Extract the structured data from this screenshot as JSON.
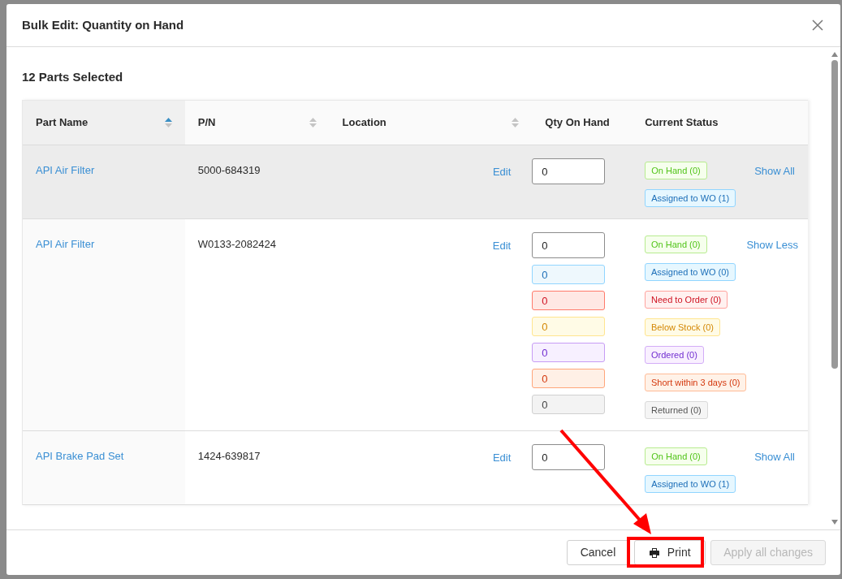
{
  "dialog": {
    "title": "Bulk Edit: Quantity on Hand",
    "subtitle": "12 Parts Selected"
  },
  "columns": [
    {
      "label": "Part Name",
      "sort_active": true
    },
    {
      "label": "P/N",
      "sort_active": false
    },
    {
      "label": "Location",
      "sort_active": false
    },
    {
      "label": "Qty On Hand"
    },
    {
      "label": "Current Status"
    }
  ],
  "rows": [
    {
      "part_name": "API Air Filter",
      "pn": "5000-684319",
      "edit": "Edit",
      "highlighted": true,
      "toggle": "Show All",
      "quantities": [
        {
          "value": "0",
          "kind": "on_hand"
        }
      ],
      "statuses": [
        {
          "label": "On Hand (0)",
          "kind": "on_hand"
        },
        {
          "label": "Assigned to WO (1)",
          "kind": "assigned"
        }
      ]
    },
    {
      "part_name": "API Air Filter",
      "pn": "W0133-2082424",
      "edit": "Edit",
      "highlighted": false,
      "toggle": "Show Less",
      "quantities": [
        {
          "value": "0",
          "kind": "on_hand"
        },
        {
          "value": "0",
          "kind": "assigned"
        },
        {
          "value": "0",
          "kind": "need"
        },
        {
          "value": "0",
          "kind": "below"
        },
        {
          "value": "0",
          "kind": "ordered"
        },
        {
          "value": "0",
          "kind": "short"
        },
        {
          "value": "0",
          "kind": "returned"
        }
      ],
      "statuses": [
        {
          "label": "On Hand (0)",
          "kind": "on_hand"
        },
        {
          "label": "Assigned to WO (0)",
          "kind": "assigned"
        },
        {
          "label": "Need to Order (0)",
          "kind": "need"
        },
        {
          "label": "Below Stock (0)",
          "kind": "below"
        },
        {
          "label": "Ordered (0)",
          "kind": "ordered"
        },
        {
          "label": "Short within 3 days (0)",
          "kind": "short"
        },
        {
          "label": "Returned (0)",
          "kind": "returned"
        }
      ]
    },
    {
      "part_name": "API Brake Pad Set",
      "pn": "1424-639817",
      "edit": "Edit",
      "highlighted": false,
      "toggle": "Show All",
      "quantities": [
        {
          "value": "0",
          "kind": "on_hand"
        }
      ],
      "statuses": [
        {
          "label": "On Hand (0)",
          "kind": "on_hand"
        },
        {
          "label": "Assigned to WO (1)",
          "kind": "assigned"
        }
      ]
    }
  ],
  "footer": {
    "cancel": "Cancel",
    "print": "Print",
    "apply": {
      "label": "Apply all changes",
      "disabled": true
    }
  }
}
